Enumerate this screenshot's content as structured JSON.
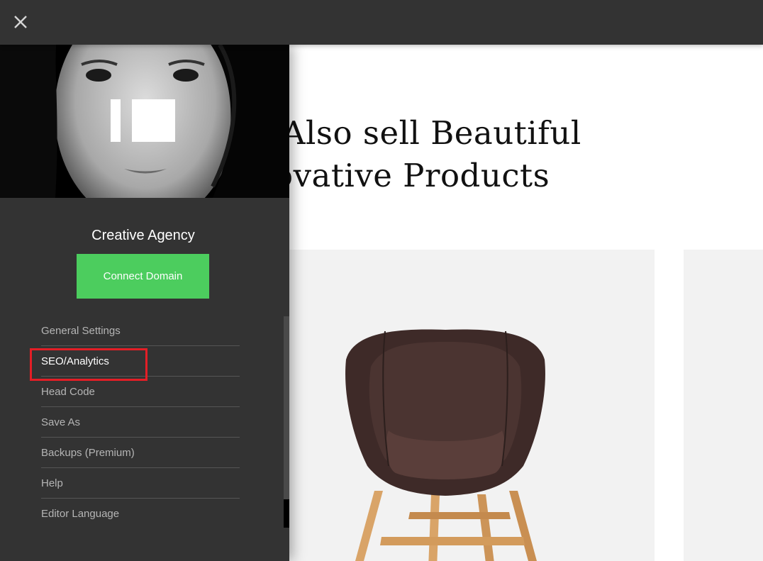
{
  "close": {
    "icon": "close-icon"
  },
  "page": {
    "headline_line1": "Also sell Beautiful",
    "headline_line2": "ovative Products"
  },
  "sidebar": {
    "site_title": "Creative Agency",
    "connect_label": "Connect Domain",
    "menu": [
      {
        "label": "General Settings"
      },
      {
        "label": "SEO/Analytics"
      },
      {
        "label": "Head Code"
      },
      {
        "label": "Save As"
      },
      {
        "label": "Backups (Premium)"
      },
      {
        "label": "Help"
      },
      {
        "label": "Editor Language"
      }
    ]
  },
  "colors": {
    "bar": "#333333",
    "accent": "#4ccd5e",
    "highlight": "#e41e26"
  }
}
